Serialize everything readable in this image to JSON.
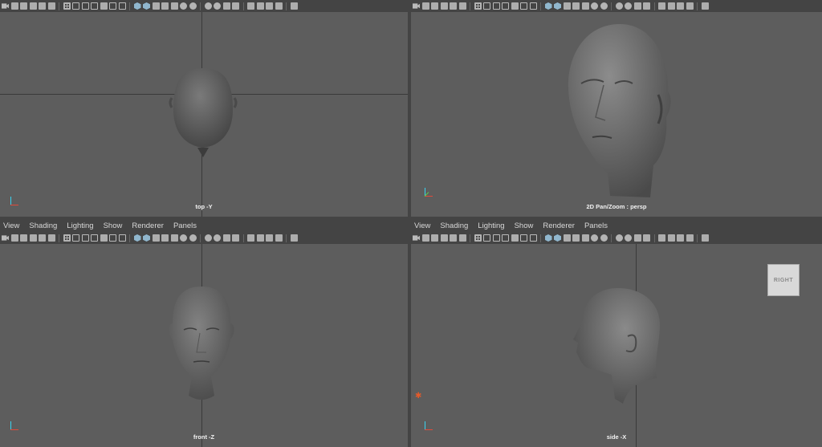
{
  "menu_items": [
    "View",
    "Shading",
    "Lighting",
    "Show",
    "Renderer",
    "Panels"
  ],
  "panels": {
    "top": {
      "camera_label": "top -Y"
    },
    "persp": {
      "camera_label": "2D Pan/Zoom : persp"
    },
    "front": {
      "camera_label": "front -Z"
    },
    "side": {
      "camera_label": "side -X",
      "view_cube_label": "RIGHT"
    }
  },
  "toolbar_icons": [
    "camera",
    "camera-attributes",
    "camera-bookmark",
    "image-plane",
    "grease-pencil",
    "2d-pan-zoom",
    "separator",
    "grid",
    "film-gate",
    "resolution-gate",
    "gate-mask",
    "field-chart",
    "safe-action",
    "safe-title",
    "separator",
    "wireframe",
    "smooth-shade",
    "wireframe-on-shaded",
    "default-material",
    "textured",
    "use-all-lights",
    "shadows",
    "separator",
    "ambient-occlusion",
    "motion-blur",
    "anti-aliasing",
    "depth-of-field",
    "separator",
    "isolate-select",
    "xray",
    "xray-joints",
    "xray-active",
    "separator",
    "backface-culling"
  ],
  "colors": {
    "viewport": "#5d5d5d",
    "chrome": "#444444",
    "active_icon": "#3a86c8"
  }
}
